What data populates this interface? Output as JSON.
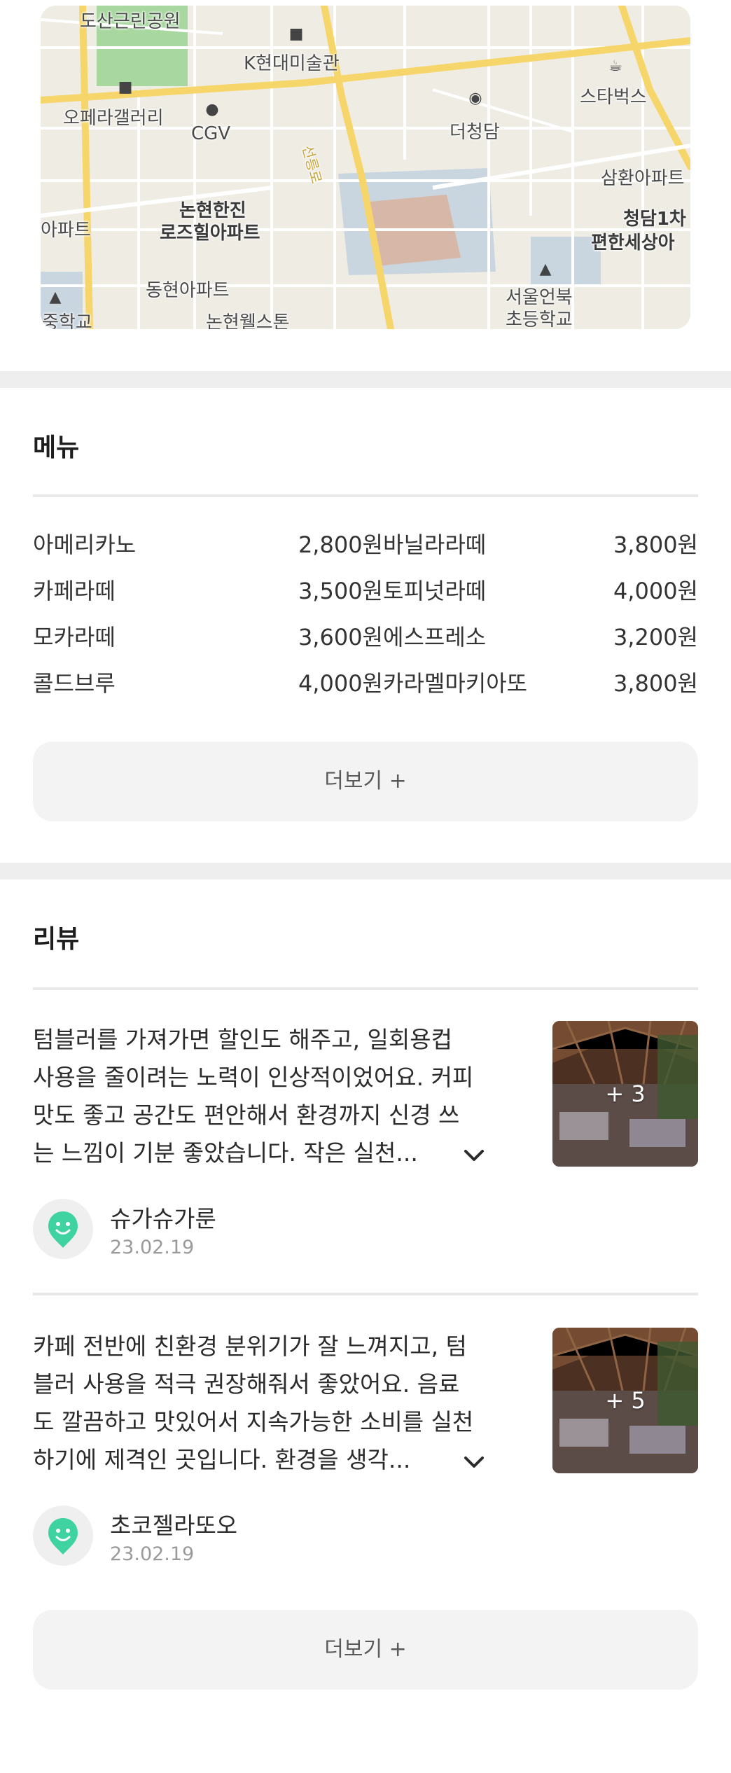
{
  "map": {
    "labels": [
      "도산근린공원",
      "K현대미술관",
      "오페라갤러리",
      "CGV",
      "스타벅스",
      "더청담",
      "삼환아파트",
      "아파트",
      "논현한진",
      "로즈힐아파트",
      "청담1차",
      "편한세상아",
      "동현아파트",
      "중학교",
      "논현웰스톤",
      "서울언북",
      "초등학교",
      "선릉로"
    ]
  },
  "menu": {
    "title": "메뉴",
    "items": [
      {
        "name": "아메리카노",
        "price": "2,800원"
      },
      {
        "name": "바닐라라떼",
        "price": "3,800원"
      },
      {
        "name": "카페라떼",
        "price": "3,500원"
      },
      {
        "name": "토피넛라떼",
        "price": "4,000원"
      },
      {
        "name": "모카라떼",
        "price": "3,600원"
      },
      {
        "name": "에스프레소",
        "price": "3,200원"
      },
      {
        "name": "콜드브루",
        "price": "4,000원"
      },
      {
        "name": "카라멜마키아또",
        "price": "3,800원"
      }
    ],
    "more_label": "더보기 +"
  },
  "reviews": {
    "title": "리뷰",
    "items": [
      {
        "lines": [
          "텀블러를 가져가면 할인도 해주고, 일회용컵",
          "사용을 줄이려는 노력이 인상적이었어요. 커피",
          "맛도 좋고 공간도 편안해서 환경까지 신경 쓰",
          "는 느낌이 기분 좋았습니다. 작은 실천..."
        ],
        "photo_count": "+ 3",
        "author": "슈가슈가룬",
        "date": "23.02.19"
      },
      {
        "lines": [
          "카페 전반에 친환경 분위기가 잘 느껴지고, 텀",
          "블러 사용을 적극 권장해줘서 좋았어요. 음료",
          "도 깔끔하고 맛있어서 지속가능한 소비를 실천",
          "하기에 제격인 곳입니다. 환경을 생각..."
        ],
        "photo_count": "+ 5",
        "author": "초코젤라또오",
        "date": "23.02.19"
      }
    ],
    "more_label": "더보기 +"
  },
  "colors": {
    "accent_green": "#3ed3a0",
    "map_road_yellow": "#f6d66b",
    "map_park": "#a8d8a0",
    "map_building": "#d7b8a8",
    "map_water": "#c9d6e0"
  }
}
